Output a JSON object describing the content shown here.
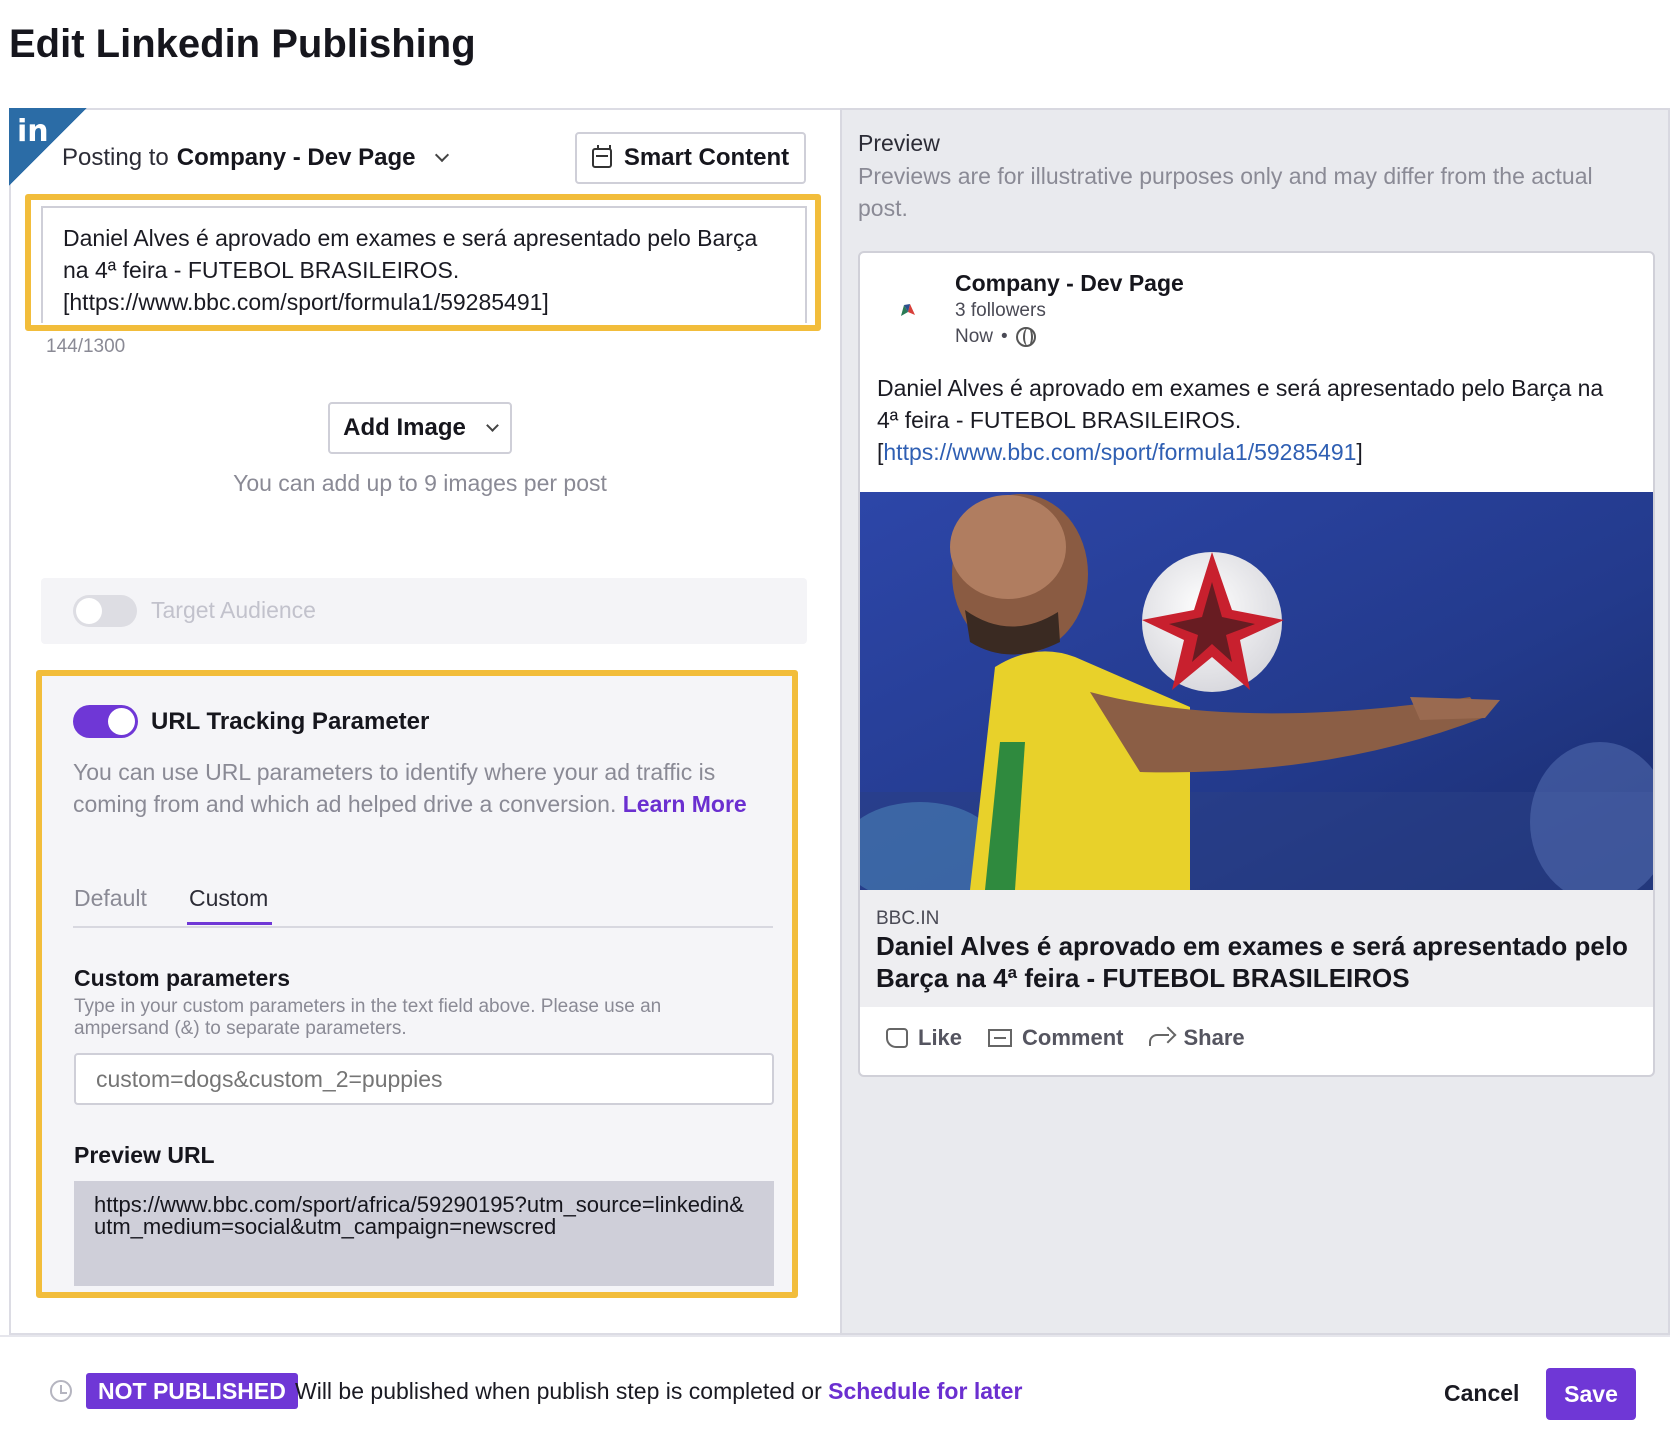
{
  "page": {
    "title": "Edit Linkedin Publishing"
  },
  "composer": {
    "network_badge": "in",
    "posting_to_label": "Posting to",
    "account_name": "Company - Dev Page",
    "smart_content_label": "Smart Content",
    "post_text_line1": "Daniel Alves é aprovado em exames e será apresentado pelo Barça",
    "post_text_line2": "na 4ª feira - FUTEBOL BRASILEIROS.",
    "post_text_line3": "[https://www.bbc.com/sport/formula1/59285491]",
    "char_count": "144/1300",
    "add_image_label": "Add Image",
    "add_image_hint": "You can add up to 9 images per post",
    "target_audience_label": "Target Audience",
    "target_audience_enabled": false
  },
  "url_tracking": {
    "enabled": true,
    "title": "URL Tracking Parameter",
    "description": "You can use URL parameters to identify where your ad traffic is coming from and which ad helped drive a conversion.",
    "learn_more": "Learn More",
    "tabs": [
      {
        "label": "Default",
        "active": false
      },
      {
        "label": "Custom",
        "active": true
      }
    ],
    "custom_title": "Custom parameters",
    "custom_hint": "Type in your custom parameters in the text field above. Please use an ampersand (&) to separate parameters.",
    "custom_placeholder": "custom=dogs&custom_2=puppies",
    "custom_value": "",
    "preview_url_title": "Preview URL",
    "preview_url": "https://www.bbc.com/sport/africa/59290195?utm_source=linkedin&utm_medium=social&utm_campaign=newscred"
  },
  "preview": {
    "label": "Preview",
    "note": "Previews are for illustrative purposes only and may differ from the actual post.",
    "company": "Company - Dev Page",
    "followers": "3 followers",
    "time": "Now",
    "separator": "•",
    "text_line1": "Daniel Alves é aprovado em exames e será apresentado pelo Barça na",
    "text_line2": "4ª feira - FUTEBOL BRASILEIROS.",
    "text_link_open": "[",
    "text_link": "https://www.bbc.com/sport/formula1/59285491",
    "text_link_close": "]",
    "domain": "BBC.IN",
    "headline": "Daniel Alves é aprovado em exames e será apresentado pelo Barça na 4ª feira - FUTEBOL BRASILEIROS",
    "actions": {
      "like": "Like",
      "comment": "Comment",
      "share": "Share"
    }
  },
  "footer": {
    "status_badge": "NOT PUBLISHED",
    "status_text": "Will be published when publish step is completed or",
    "schedule_link": "Schedule for later",
    "cancel": "Cancel",
    "save": "Save"
  },
  "colors": {
    "accent": "#6f37d6",
    "highlight": "#f2bd3b",
    "linkedin": "#2b6ca6"
  }
}
